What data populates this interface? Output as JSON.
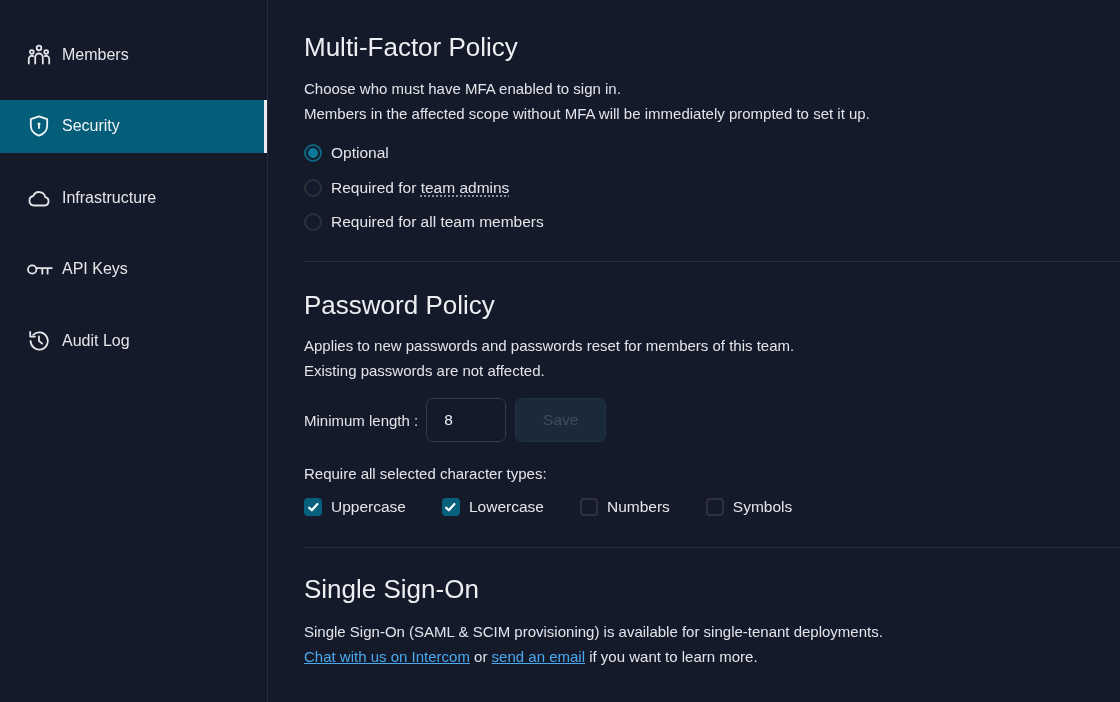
{
  "sidebar": {
    "items": [
      {
        "label": "Members",
        "selected": false
      },
      {
        "label": "Security",
        "selected": true
      },
      {
        "label": "Infrastructure",
        "selected": false
      },
      {
        "label": "API Keys",
        "selected": false
      },
      {
        "label": "Audit Log",
        "selected": false
      }
    ]
  },
  "mfa_policy": {
    "title": "Multi-Factor Policy",
    "description": [
      "Choose who must have MFA enabled to sign in.",
      "Members in the affected scope without MFA will be immediately prompted to set it up."
    ],
    "options": [
      {
        "label": "Optional",
        "selected": true
      },
      {
        "label": "Required for",
        "term": "team admins",
        "selected": false
      },
      {
        "label": "Required for all team members",
        "selected": false
      }
    ]
  },
  "password_policy": {
    "title": "Password Policy",
    "description": [
      "Applies to new passwords and passwords reset for members of this team.",
      "Existing passwords are not affected."
    ],
    "min_length": {
      "label": "Minimum length :",
      "value": "8"
    },
    "save_button": {
      "label": "Save",
      "disabled": true
    },
    "character_types": {
      "label": "Require all selected character types:",
      "options": [
        {
          "label": "Uppercase",
          "checked": true
        },
        {
          "label": "Lowercase",
          "checked": true
        },
        {
          "label": "Numbers",
          "checked": false
        },
        {
          "label": "Symbols",
          "checked": false
        }
      ]
    }
  },
  "single_sign_on": {
    "title": "Single Sign-On",
    "description": "Single Sign-On (SAML & SCIM provisioning) is available for single-tenant deployments.",
    "contact": [
      {
        "kind": "link",
        "text": "Chat with us on Intercom"
      },
      {
        "kind": "text",
        "text": "or"
      },
      {
        "kind": "link",
        "text": "send an email"
      },
      {
        "kind": "text",
        "text": "if you want to learn more."
      }
    ]
  }
}
